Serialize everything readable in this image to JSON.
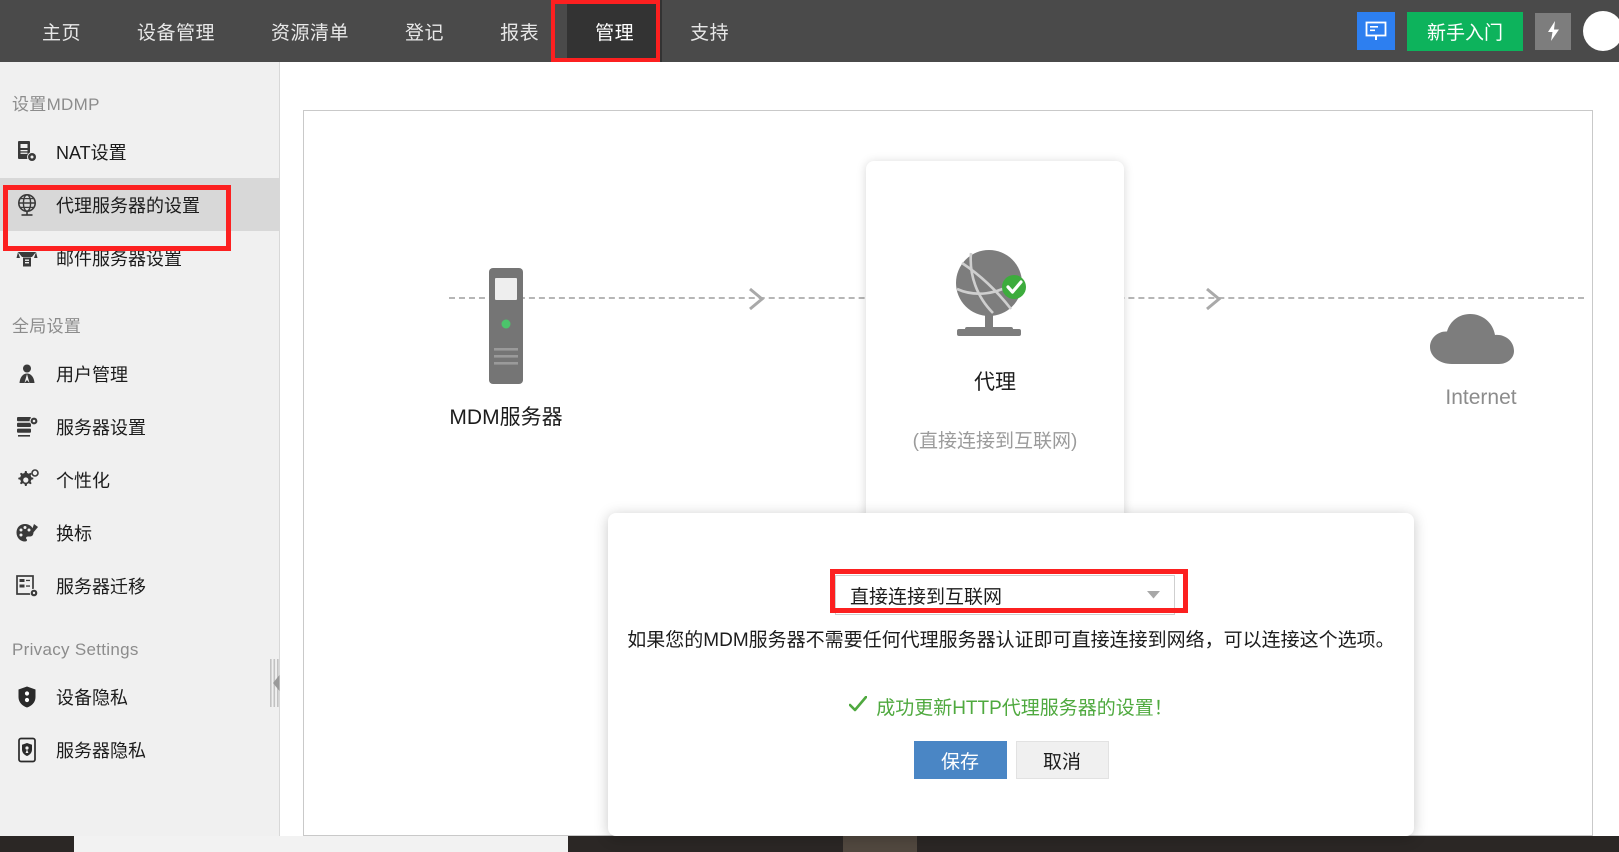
{
  "topbar": {
    "nav": [
      {
        "label": "主页",
        "active": false
      },
      {
        "label": "设备管理",
        "active": false
      },
      {
        "label": "资源清单",
        "active": false
      },
      {
        "label": "登记",
        "active": false
      },
      {
        "label": "报表",
        "active": false
      },
      {
        "label": "管理",
        "active": true
      },
      {
        "label": "支持",
        "active": false
      }
    ],
    "presentation_icon": "presentation-screen-icon",
    "onboarding_button": "新手入门",
    "flash_icon": "lightning-bolt-icon",
    "avatar": "user-avatar",
    "bg_color": "#4a4a4a",
    "active_bg_color": "#333333",
    "green_color": "#0db35c",
    "blue_color": "#2d7ff0"
  },
  "sidebar": {
    "sections": [
      {
        "title": "设置MDMP",
        "items": [
          {
            "label": "NAT设置",
            "icon": "server-gear-icon",
            "selected": false
          },
          {
            "label": "代理服务器的设置",
            "icon": "globe-icon",
            "selected": true
          },
          {
            "label": "邮件服务器设置",
            "icon": "mail-server-icon",
            "selected": false
          }
        ]
      },
      {
        "title": "全局设置",
        "items": [
          {
            "label": "用户管理",
            "icon": "users-icon",
            "selected": false
          },
          {
            "label": "服务器设置",
            "icon": "server-settings-icon",
            "selected": false
          },
          {
            "label": "个性化",
            "icon": "gear-personalize-icon",
            "selected": false
          },
          {
            "label": "换标",
            "icon": "palette-brush-icon",
            "selected": false
          },
          {
            "label": "服务器迁移",
            "icon": "server-migrate-icon",
            "selected": false
          }
        ]
      },
      {
        "title": "Privacy Settings",
        "items": [
          {
            "label": "设备隐私",
            "icon": "shield-device-icon",
            "selected": false
          },
          {
            "label": "服务器隐私",
            "icon": "phone-shield-icon",
            "selected": false
          }
        ]
      }
    ],
    "collapse_handle": "collapse-sidebar-handle"
  },
  "diagram": {
    "mdm_label": "MDM服务器",
    "proxy_label": "代理",
    "proxy_sublabel": "(直接连接到互联网)",
    "internet_label": "Internet",
    "status_badge": "check-circle-green",
    "status_color": "#3dac3d"
  },
  "dialog": {
    "select_value": "直接连接到互联网",
    "select_caret": "chevron-down-icon",
    "hint": "如果您的MDM服务器不需要任何代理服务器认证即可直接连接到网络，可以连接这个选项。",
    "success_message": "成功更新HTTP代理服务器的设置！",
    "success_icon": "check-mark-green",
    "success_color": "#4fa93f",
    "save_label": "保存",
    "cancel_label": "取消",
    "save_color": "#4a86c5"
  },
  "highlights": {
    "color": "#fc2020",
    "regions": [
      "nav-item-管理",
      "sidebar-item-代理服务器的设置",
      "proxy-type-select"
    ]
  }
}
